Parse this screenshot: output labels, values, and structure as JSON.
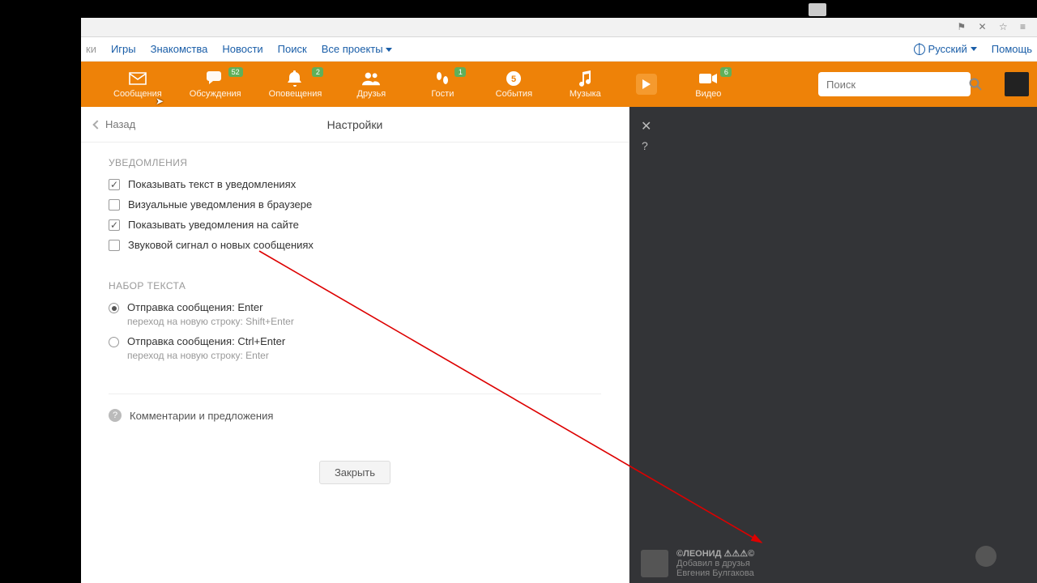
{
  "topnav": {
    "cut": "ки",
    "items": [
      "Игры",
      "Знакомства",
      "Новости",
      "Поиск",
      "Все проекты"
    ],
    "lang": "Русский",
    "help": "Помощь"
  },
  "orange": {
    "items": [
      {
        "key": "messages",
        "label": "Сообщения",
        "badge": null
      },
      {
        "key": "discuss",
        "label": "Обсуждения",
        "badge": "52"
      },
      {
        "key": "notif",
        "label": "Оповещения",
        "badge": "2"
      },
      {
        "key": "friends",
        "label": "Друзья",
        "badge": null
      },
      {
        "key": "guests",
        "label": "Гости",
        "badge": "1"
      },
      {
        "key": "events",
        "label": "События",
        "badge": null
      },
      {
        "key": "music",
        "label": "Музыка",
        "badge": null
      },
      {
        "key": "video",
        "label": "Видео",
        "badge": "6"
      }
    ],
    "search_placeholder": "Поиск"
  },
  "panel": {
    "back": "Назад",
    "title": "Настройки",
    "notif_title": "УВЕДОМЛЕНИЯ",
    "checks": [
      {
        "label": "Показывать текст в уведомлениях",
        "on": true
      },
      {
        "label": "Визуальные уведомления в браузере",
        "on": false
      },
      {
        "label": "Показывать уведомления на сайте",
        "on": true
      },
      {
        "label": "Звуковой сигнал о новых сообщениях",
        "on": false
      }
    ],
    "typing_title": "НАБОР ТЕКСТА",
    "radios": [
      {
        "label": "Отправка сообщения: Enter",
        "sub": "переход на новую строку: Shift+Enter",
        "on": true
      },
      {
        "label": "Отправка сообщения: Ctrl+Enter",
        "sub": "переход на новую строку: Enter",
        "on": false
      }
    ],
    "feedback": "Комментарии и предложения",
    "close": "Закрыть"
  },
  "feed": {
    "name": "©ЛЕОНИД ⚠⚠⚠©",
    "action": "Добавил в друзья",
    "who": "Евгения Булгакова"
  }
}
